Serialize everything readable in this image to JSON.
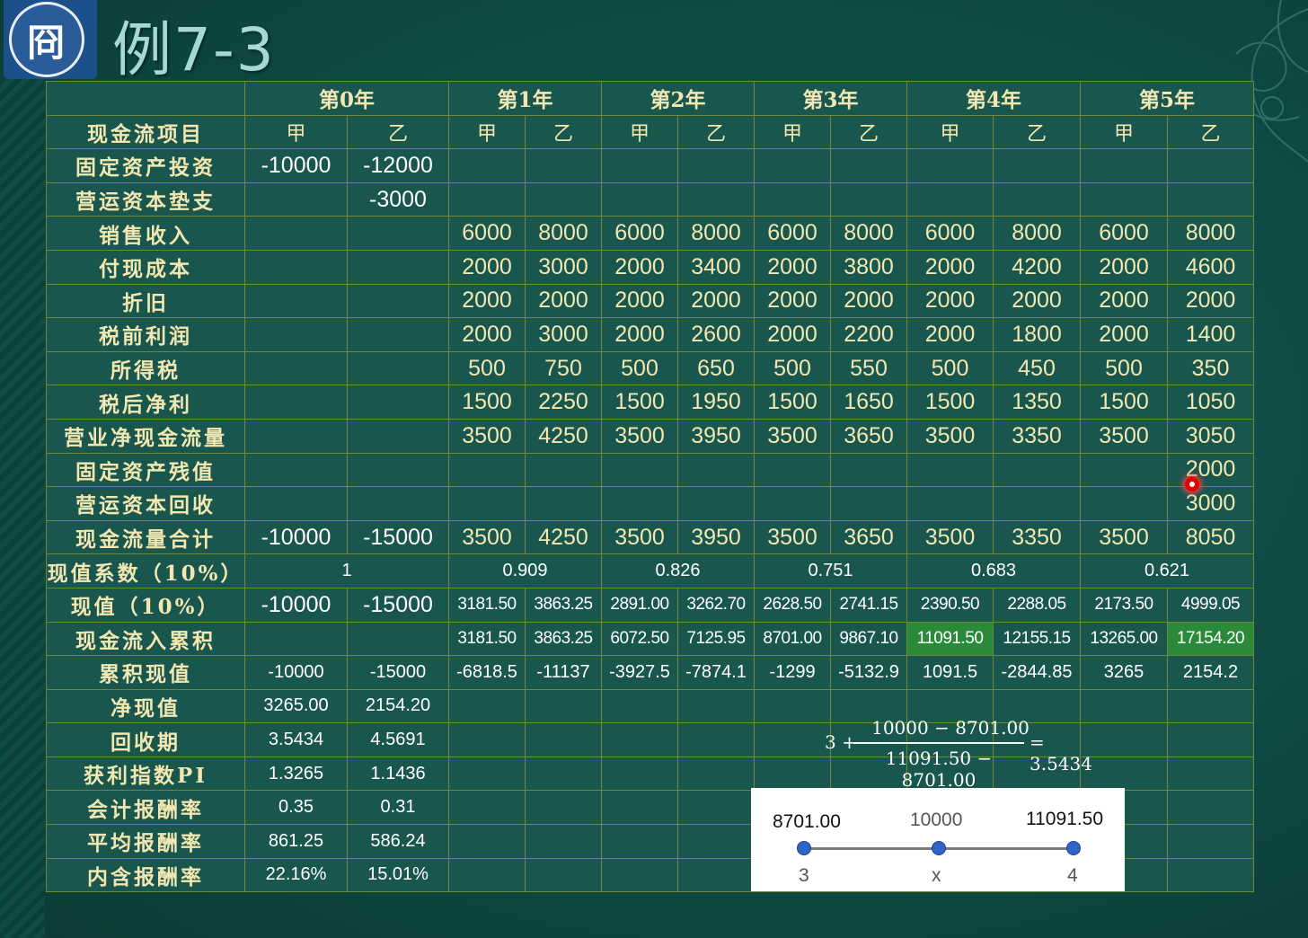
{
  "title": "例7-3",
  "logo": {
    "glyph": "冏"
  },
  "table": {
    "year_headers": [
      "第0年",
      "第1年",
      "第2年",
      "第3年",
      "第4年",
      "第5年"
    ],
    "sub_header_label": "现金流项目",
    "sub_headers": [
      "甲",
      "乙",
      "甲",
      "乙",
      "甲",
      "乙",
      "甲",
      "乙",
      "甲",
      "乙",
      "甲",
      "乙"
    ],
    "rows": [
      {
        "label": "固定资产投资",
        "cells": [
          "-10000",
          "-12000",
          "",
          "",
          "",
          "",
          "",
          "",
          "",
          "",
          "",
          ""
        ]
      },
      {
        "label": "营运资本垫支",
        "cells": [
          "",
          "-3000",
          "",
          "",
          "",
          "",
          "",
          "",
          "",
          "",
          "",
          ""
        ]
      },
      {
        "label": "销售收入",
        "cells": [
          "",
          "",
          "6000",
          "8000",
          "6000",
          "8000",
          "6000",
          "8000",
          "6000",
          "8000",
          "6000",
          "8000"
        ]
      },
      {
        "label": "付现成本",
        "cells": [
          "",
          "",
          "2000",
          "3000",
          "2000",
          "3400",
          "2000",
          "3800",
          "2000",
          "4200",
          "2000",
          "4600"
        ]
      },
      {
        "label": "折旧",
        "cells": [
          "",
          "",
          "2000",
          "2000",
          "2000",
          "2000",
          "2000",
          "2000",
          "2000",
          "2000",
          "2000",
          "2000"
        ]
      },
      {
        "label": "税前利润",
        "cells": [
          "",
          "",
          "2000",
          "3000",
          "2000",
          "2600",
          "2000",
          "2200",
          "2000",
          "1800",
          "2000",
          "1400"
        ]
      },
      {
        "label": "所得税",
        "cells": [
          "",
          "",
          "500",
          "750",
          "500",
          "650",
          "500",
          "550",
          "500",
          "450",
          "500",
          "350"
        ]
      },
      {
        "label": "税后净利",
        "cells": [
          "",
          "",
          "1500",
          "2250",
          "1500",
          "1950",
          "1500",
          "1650",
          "1500",
          "1350",
          "1500",
          "1050"
        ]
      },
      {
        "label": "营业净现金流量",
        "cells": [
          "",
          "",
          "3500",
          "4250",
          "3500",
          "3950",
          "3500",
          "3650",
          "3500",
          "3350",
          "3500",
          "3050"
        ]
      },
      {
        "label": "固定资产残值",
        "cells": [
          "",
          "",
          "",
          "",
          "",
          "",
          "",
          "",
          "",
          "",
          "",
          "2000"
        ]
      },
      {
        "label": "营运资本回收",
        "cells": [
          "",
          "",
          "",
          "",
          "",
          "",
          "",
          "",
          "",
          "",
          "",
          "3000"
        ]
      },
      {
        "label": "现金流量合计",
        "cells": [
          "-10000",
          "-15000",
          "3500",
          "4250",
          "3500",
          "3950",
          "3500",
          "3650",
          "3500",
          "3350",
          "3500",
          "8050"
        ]
      }
    ],
    "pv_factor": {
      "label": "现值系数（10%）",
      "values": [
        "1",
        "0.909",
        "0.826",
        "0.751",
        "0.683",
        "0.621"
      ]
    },
    "pv": {
      "label": "现值（10%）",
      "cells": [
        "-10000",
        "-15000",
        "3181.50",
        "3863.25",
        "2891.00",
        "3262.70",
        "2628.50",
        "2741.15",
        "2390.50",
        "2288.05",
        "2173.50",
        "4999.05"
      ]
    },
    "cum_inflow": {
      "label": "现金流入累积",
      "cells": [
        "",
        "",
        "3181.50",
        "3863.25",
        "6072.50",
        "7125.95",
        "8701.00",
        "9867.10",
        "11091.50",
        "12155.15",
        "13265.00",
        "17154.20"
      ]
    },
    "cum_pv": {
      "label": "累积现值",
      "cells": [
        "-10000",
        "-15000",
        "-6818.5",
        "-11137",
        "-3927.5",
        "-7874.1",
        "-1299",
        "-5132.9",
        "1091.5",
        "-2844.85",
        "3265",
        "2154.2"
      ]
    },
    "metrics": [
      {
        "label": "净现值",
        "a": "3265.00",
        "b": "2154.20"
      },
      {
        "label": "回收期",
        "a": "3.5434",
        "b": "4.5691"
      },
      {
        "label": "获利指数PI",
        "a": "1.3265",
        "b": "1.1436"
      },
      {
        "label": "会计报酬率",
        "a": "0.35",
        "b": "0.31"
      },
      {
        "label": "平均报酬率",
        "a": "861.25",
        "b": "586.24"
      },
      {
        "label": "内含报酬率",
        "a": "22.16%",
        "b": "15.01%"
      }
    ]
  },
  "formula": {
    "prefix": "3 +",
    "numerator": "10000 − 8701.00",
    "denominator": "11091.50 − 8701.00",
    "result": "= 3.5434"
  },
  "number_line": {
    "left_value": "8701.00",
    "mid_value": "10000",
    "right_value": "11091.50",
    "left_tick": "3",
    "mid_tick": "x",
    "right_tick": "4"
  },
  "colors": {
    "background": "#0f4a44",
    "cell": "#19564e",
    "border": "#6c8a34",
    "label_text": "#f2e7b0",
    "highlight": "#2b8a3a"
  }
}
